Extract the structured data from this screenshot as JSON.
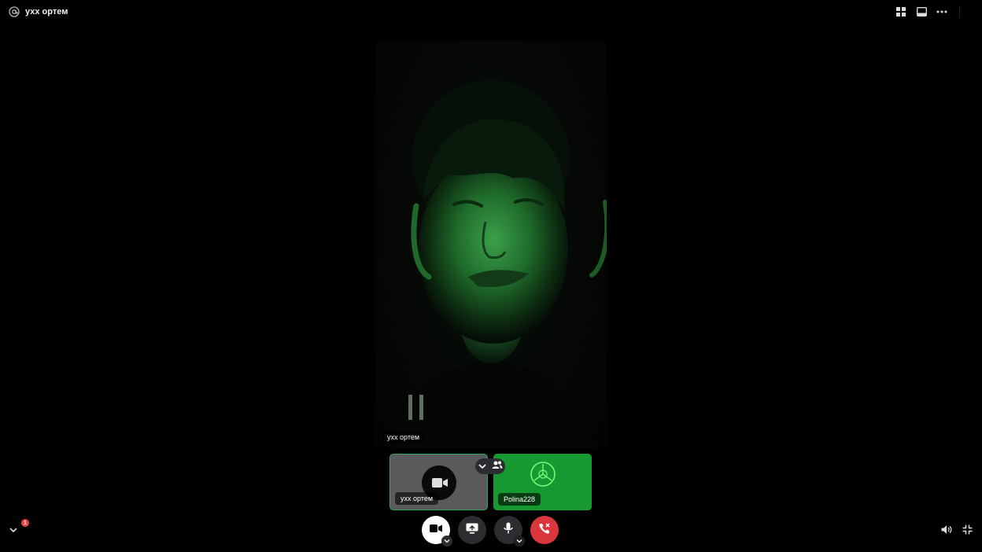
{
  "header": {
    "title": "ухх ортем"
  },
  "main_video": {
    "name": "ухх ортем"
  },
  "thumbnails": [
    {
      "name": "ухх ортем"
    },
    {
      "name": "Polina228"
    }
  ],
  "notification_badge": "1",
  "colors": {
    "accent_green": "#23a55a",
    "end_call_red": "#da373c",
    "control_dark": "#2b2d31"
  }
}
